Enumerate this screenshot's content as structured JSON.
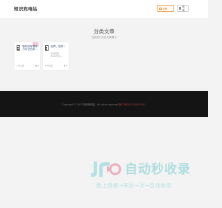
{
  "header": {
    "site_name": "知识充电站",
    "contribute_button": "投稿",
    "login_button": "登录"
  },
  "main": {
    "title": "分类文章",
    "subtitle": "当前热门分类文章展示",
    "cards": [
      {
        "title": "临时的有限学习与记忆研...",
        "description": "",
        "category": "开心果",
        "views": "0",
        "has_tag": true
      },
      {
        "title": "世界，您好！",
        "description": "欢迎使用WordPres...",
        "category": "开心果",
        "views": "0",
        "has_tag": false
      }
    ]
  },
  "footer": {
    "copyright_prefix": "Copyright © 2023",
    "site_link": "知识充电站",
    "rights": "· All rights reserved",
    "icp": "备ICP备2023000001号-1"
  },
  "watermark": {
    "main": "自动秒收录",
    "sub": "数上链接→来访一次→自动收录"
  },
  "colors": {
    "accent_orange": "#f0a04b",
    "card_title_blue": "#2b4d7a",
    "footer_bg": "#141414",
    "watermark_teal": "#5cc4c8"
  },
  "icons": {
    "contribute": "image-icon",
    "login": "user-icon",
    "card": "document-icon"
  }
}
